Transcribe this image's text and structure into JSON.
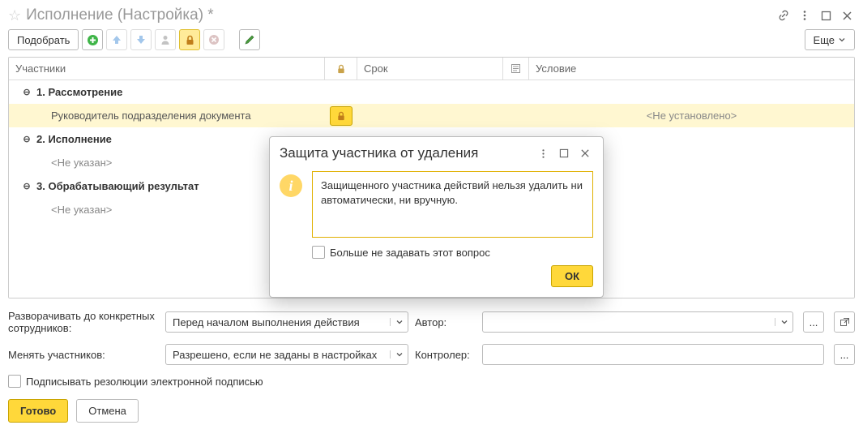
{
  "title": "Исполнение (Настройка) *",
  "toolbar": {
    "pick": "Подобрать",
    "more": "Еще"
  },
  "table": {
    "headers": {
      "participants": "Участники",
      "deadline": "Срок",
      "condition": "Условие"
    },
    "rows": {
      "g1": "1. Рассмотрение",
      "g1_leaf": "Руководитель подразделения документа",
      "g1_cond": "<Не установлено>",
      "g2": "2. Исполнение",
      "g2_leaf": "<Не указан>",
      "g3": "3. Обрабатывающий результат",
      "g3_leaf": "<Не указан>"
    }
  },
  "form": {
    "expand_label": "Разворачивать до конкретных сотрудников:",
    "expand_value": "Перед началом выполнения действия",
    "author_label": "Автор:",
    "change_label": "Менять участников:",
    "change_value": "Разрешено, если не заданы в настройках",
    "controller_label": "Контролер:",
    "sign_label": "Подписывать резолюции электронной подписью",
    "done": "Готово",
    "cancel": "Отмена"
  },
  "dialog": {
    "title": "Защита участника от удаления",
    "message": "Защищенного участника действий нельзя удалить ни автоматически, ни вручную.",
    "dont_ask": "Больше не задавать этот вопрос",
    "ok": "ОК"
  }
}
